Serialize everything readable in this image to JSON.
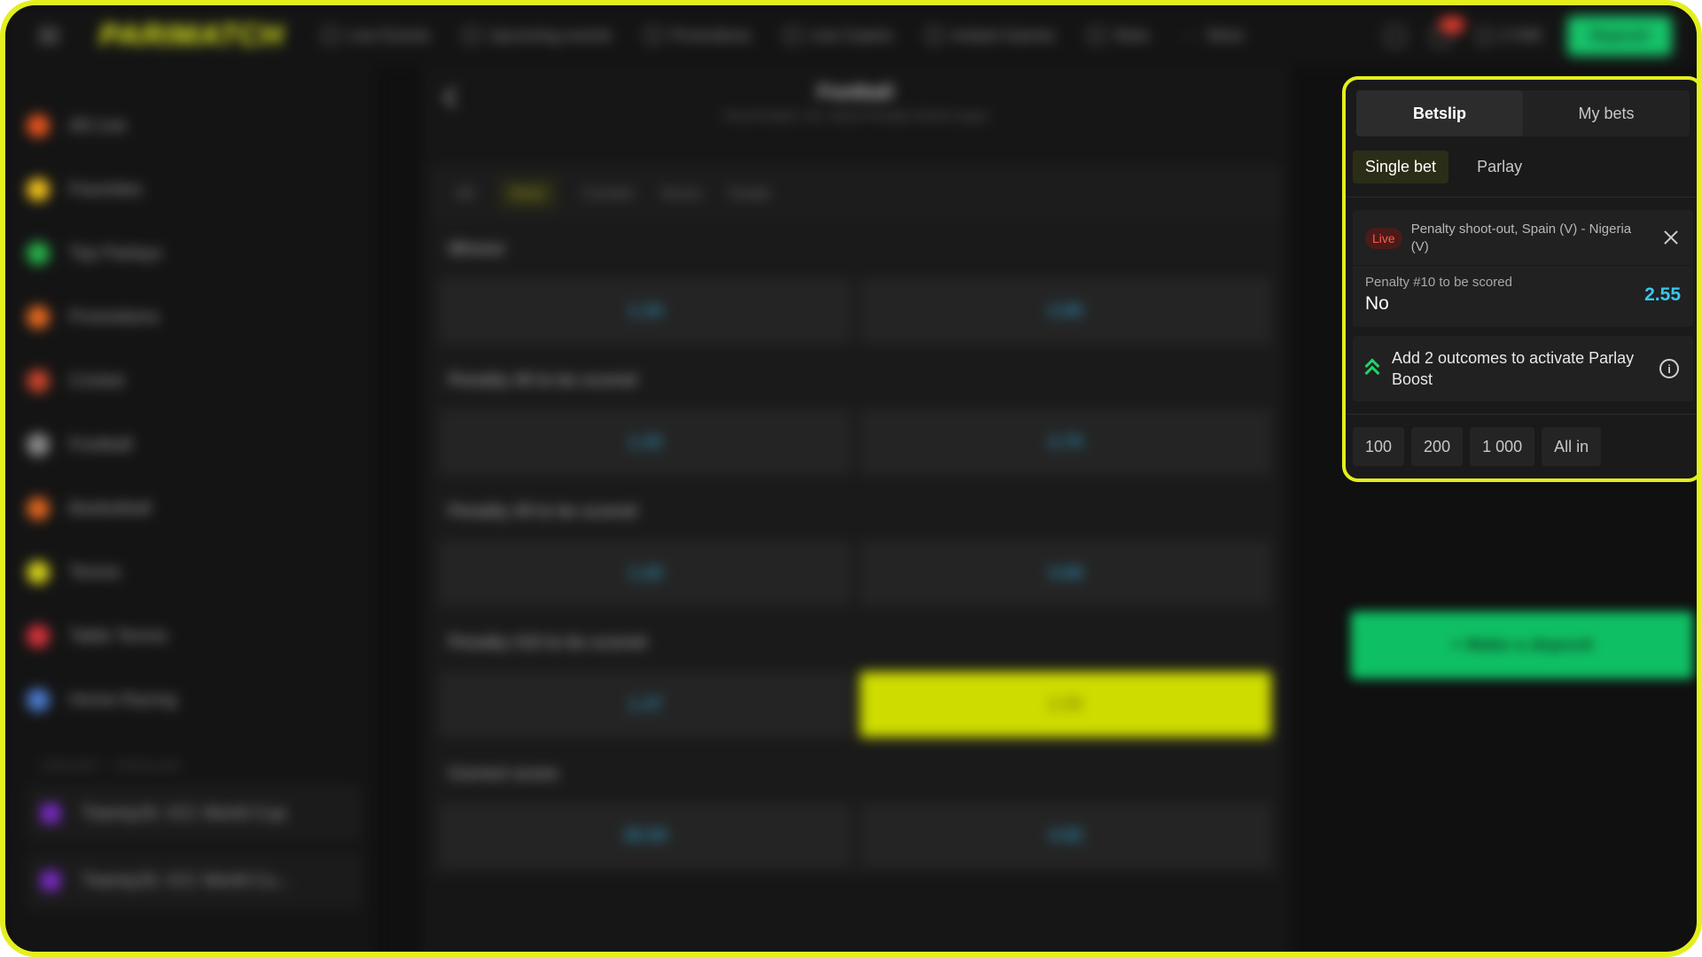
{
  "topbar": {
    "logo": "PARIMATCH",
    "nav": [
      "Live Events",
      "Upcoming events",
      "Promotions",
      "Live Casino",
      "Instant Games",
      "Slots",
      "More"
    ],
    "balance": "0 INR",
    "deposit": "Deposit"
  },
  "sidebar": {
    "items": [
      "All Live",
      "Favorites",
      "Top Parlays",
      "Promotions",
      "Cricket",
      "Football",
      "Basketball",
      "Tennis",
      "Table Tennis",
      "Horse Racing"
    ],
    "icon_colors": [
      "#e8541f",
      "#f2c21a",
      "#27b34a",
      "#e86a1f",
      "#c9452b",
      "#8a8a8a",
      "#e0661f",
      "#d7d21b",
      "#d8323c",
      "#4a7bd0"
    ],
    "section": "CRICKET · POPULAR",
    "cards": [
      "Twenty20. ICC World Cup",
      "Twenty20. ICC World Cu..."
    ]
  },
  "event": {
    "title": "Football",
    "subtitle": "Virtual football. USL. Beach Penalties World League",
    "tabs": [
      "All",
      "Main",
      "Combo",
      "Score",
      "Goals"
    ],
    "markets": [
      {
        "title": "Winner",
        "odds": [
          "1.34",
          "2.85"
        ]
      },
      {
        "title": "Penalty #8 to be scored",
        "odds": [
          "1.32",
          "2.70"
        ]
      },
      {
        "title": "Penalty #9 to be scored",
        "odds": [
          "1.20",
          "3.69"
        ]
      },
      {
        "title": "Penalty #10 to be scored",
        "odds": [
          "1.37",
          "2.55"
        ]
      },
      {
        "title": "Correct score",
        "odds": [
          "30.50",
          "4.92"
        ]
      }
    ]
  },
  "betslip": {
    "tabs": [
      "Betslip",
      "My bets"
    ],
    "types": [
      "Single bet",
      "Parlay"
    ],
    "bet": {
      "live_badge": "Live",
      "event": "Penalty shoot-out, Spain (V) - Nigeria (V)",
      "market": "Penalty #10 to be scored",
      "outcome": "No",
      "odds": "2.55"
    },
    "boost": "Add 2 outcomes to activate Parlay Boost",
    "info_icon": "i",
    "stakes": [
      "100",
      "200",
      "1 000",
      "All in"
    ]
  },
  "make_deposit": "+ Make a deposit",
  "colors": {
    "accent": "#e4ef1e",
    "live": "#ff5a4a",
    "odds": "#37c8f0",
    "boost": "#22d36c",
    "deposit": "#0fbf64"
  }
}
